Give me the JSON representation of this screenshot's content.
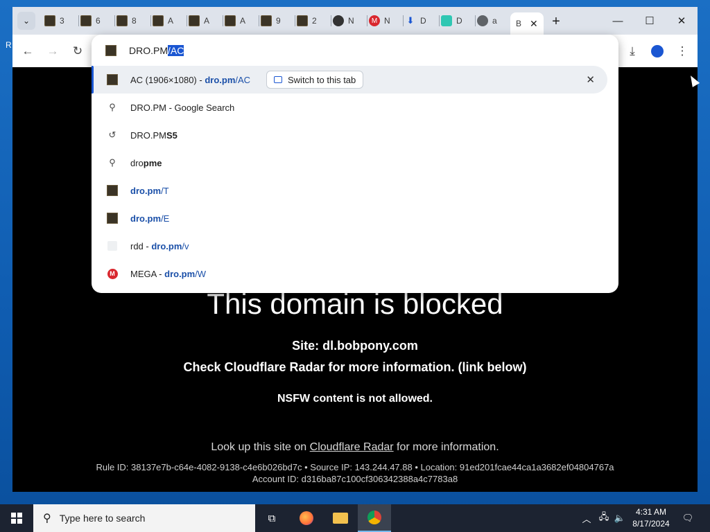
{
  "desktop": {
    "edge_letters": [
      "R"
    ]
  },
  "tabs": [
    {
      "title": "3",
      "icon": "image-icon"
    },
    {
      "title": "6",
      "icon": "image-icon"
    },
    {
      "title": "8",
      "icon": "image-icon"
    },
    {
      "title": "A",
      "icon": "image-icon"
    },
    {
      "title": "A",
      "icon": "image-icon"
    },
    {
      "title": "A",
      "icon": "image-icon"
    },
    {
      "title": "9",
      "icon": "image-icon"
    },
    {
      "title": "2",
      "icon": "image-icon"
    },
    {
      "title": "N",
      "icon": "github-icon"
    },
    {
      "title": "N",
      "icon": "mega-icon"
    },
    {
      "title": "D",
      "icon": "download-icon"
    },
    {
      "title": "D",
      "icon": "drop-icon"
    },
    {
      "title": "a",
      "icon": "globe-icon"
    }
  ],
  "active_tab": {
    "title": "B"
  },
  "omnibox": {
    "typed": "DRO.PM",
    "autocomplete": "/AC"
  },
  "suggestions": [
    {
      "plain": "AC (1906×1080) - ",
      "url_bold": "dro.pm",
      "url_rest": "/AC",
      "icon": "image-icon",
      "switch_label": "Switch to this tab"
    },
    {
      "plain": "DRO.PM - Google Search",
      "icon": "search-icon"
    },
    {
      "plain": "DRO.PM",
      "bold": "S5",
      "icon": "history-icon"
    },
    {
      "plain": "dro",
      "bold": "pme",
      "icon": "search-icon"
    },
    {
      "url_bold": "dro.pm",
      "url_rest": "/T",
      "icon": "image-icon"
    },
    {
      "url_bold": "dro.pm",
      "url_rest": "/E",
      "icon": "image-icon"
    },
    {
      "plain": "rdd - ",
      "url_bold": "dro.pm",
      "url_rest": "/v",
      "icon": "blank-page-icon"
    },
    {
      "plain": "MEGA - ",
      "url_bold": "dro.pm",
      "url_rest": "/W",
      "icon": "mega-icon"
    }
  ],
  "page": {
    "heading": "This domain is blocked",
    "site": "Site: dl.bobpony.com",
    "check": "Check Cloudflare Radar for more information. (link below)",
    "nsfw": "NSFW content is not allowed.",
    "lookup_pre": "Look up this site on ",
    "lookup_link": "Cloudflare Radar",
    "lookup_post": " for more information.",
    "rule": "Rule ID: 38137e7b-c64e-4082-9138-c4e6b026bd7c • Source IP: 143.244.47.88 • Location: 91ed201fcae44ca1a3682ef04804767a",
    "account": "Account ID: d316ba87c100cf306342388a4c7783a8"
  },
  "taskbar": {
    "search_placeholder": "Type here to search",
    "time": "4:31 AM",
    "date": "8/17/2024"
  },
  "colors": {
    "accent": "#1a56d2",
    "page_bg": "#000000",
    "tabstrip": "#dee3eb",
    "taskbar": "#1c2331"
  }
}
